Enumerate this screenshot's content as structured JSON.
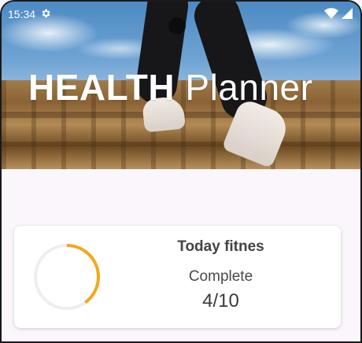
{
  "status_bar": {
    "time": "15:34",
    "settings_icon": "gear-icon",
    "wifi_icon": "wifi-icon",
    "signal_icon": "signal-icon"
  },
  "hero": {
    "title_bold": "HEALTH",
    "title_light": "Planner"
  },
  "card": {
    "title": "Today fitnes",
    "subtitle": "Complete",
    "count_text": "4/10",
    "progress": 0.4,
    "ring_color": "#f2a81d",
    "ring_track_color": "#eeeeee"
  }
}
